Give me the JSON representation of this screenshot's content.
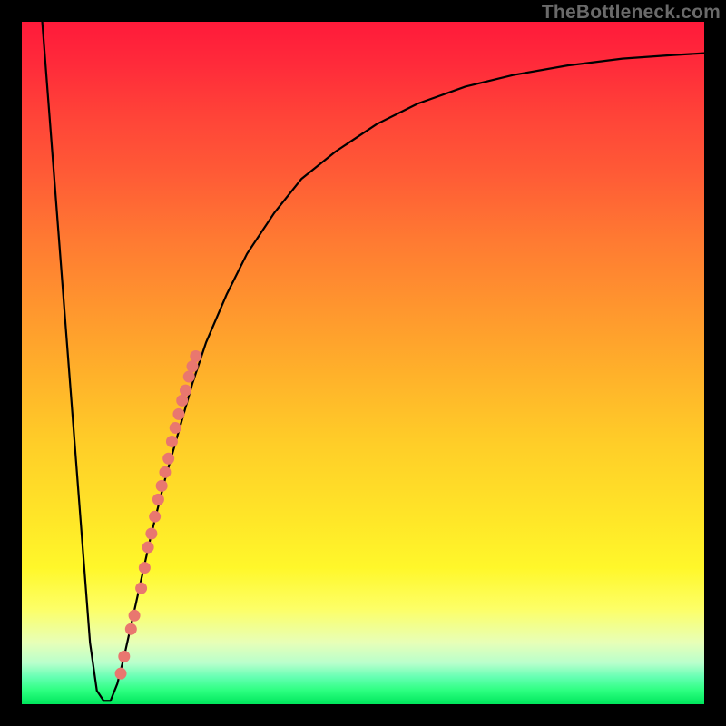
{
  "watermark": "TheBottleneck.com",
  "colors": {
    "curve_stroke": "#000000",
    "marker_fill": "#e9776f",
    "marker_stroke": "#e9776f"
  },
  "chart_data": {
    "type": "line",
    "title": "",
    "xlabel": "",
    "ylabel": "",
    "xlim": [
      0,
      100
    ],
    "ylim": [
      0,
      100
    ],
    "curve": {
      "x": [
        3,
        5,
        7,
        9,
        10,
        11,
        12,
        13,
        14,
        15,
        17,
        19,
        21,
        23,
        25,
        27,
        30,
        33,
        37,
        41,
        46,
        52,
        58,
        65,
        72,
        80,
        88,
        95,
        100
      ],
      "y": [
        100,
        74,
        48,
        22,
        9,
        2,
        0.5,
        0.5,
        3,
        7,
        16,
        25,
        33,
        40,
        47,
        53,
        60,
        66,
        72,
        77,
        81,
        85,
        88,
        90.5,
        92.2,
        93.6,
        94.6,
        95.1,
        95.4
      ]
    },
    "markers": {
      "x": [
        14.5,
        15.0,
        16.0,
        16.5,
        17.5,
        18.0,
        18.5,
        19.0,
        19.5,
        20.0,
        20.5,
        21.0,
        21.5,
        22.0,
        22.5,
        23.0,
        23.5,
        24.0,
        24.5,
        25.0,
        25.5
      ],
      "y": [
        4.5,
        7.0,
        11.0,
        13.0,
        17.0,
        20.0,
        23.0,
        25.0,
        27.5,
        30.0,
        32.0,
        34.0,
        36.0,
        38.5,
        40.5,
        42.5,
        44.5,
        46.0,
        48.0,
        49.5,
        51.0
      ]
    },
    "marker_radius_px": 6
  }
}
